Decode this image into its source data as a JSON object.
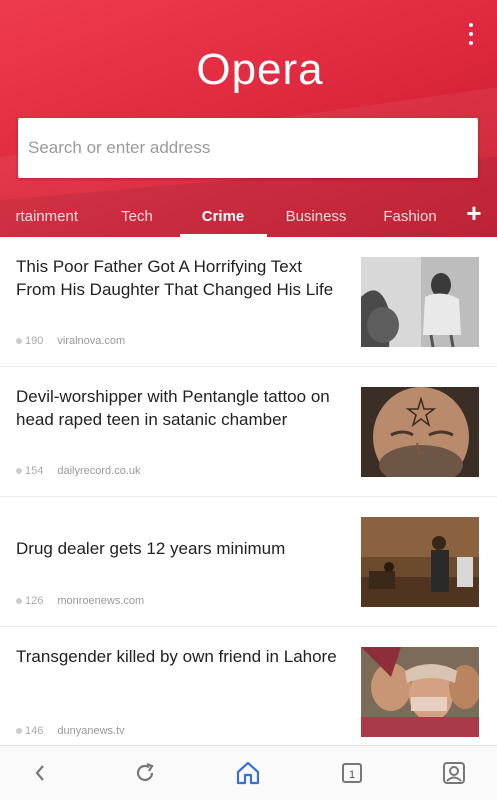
{
  "header": {
    "logo": "Opera",
    "search_placeholder": "Search or enter address"
  },
  "tabs": [
    {
      "label": "rtainment"
    },
    {
      "label": "Tech"
    },
    {
      "label": "Crime",
      "active": true
    },
    {
      "label": "Business"
    },
    {
      "label": "Fashion"
    }
  ],
  "articles": [
    {
      "title": "This Poor Father Got A Horrifying Text From His Daughter That Changed His Life",
      "count": "190",
      "source": "viralnova.com",
      "image": "grayscale-man-fist-and-girl-photo"
    },
    {
      "title": "Devil-worshipper with Pentangle tattoo on head raped teen in satanic chamber",
      "count": "154",
      "source": "dailyrecord.co.uk",
      "image": "man-with-pentagram-forehead-tattoo-photo"
    },
    {
      "title": "Drug dealer gets 12 years minimum",
      "count": "126",
      "source": "monroenews.com",
      "image": "courtroom-photo"
    },
    {
      "title": "Transgender killed by own friend in Lahore",
      "count": "146",
      "source": "dunyanews.tv",
      "image": "crying-women-photo"
    }
  ],
  "bottom_nav": {
    "icons": [
      "back-icon",
      "reload-icon",
      "home-icon",
      "tabs-icon",
      "account-icon"
    ],
    "tab_count": "1"
  },
  "colors": {
    "brand_red": "#e02a3f",
    "active_nav": "#3b6fd8"
  }
}
